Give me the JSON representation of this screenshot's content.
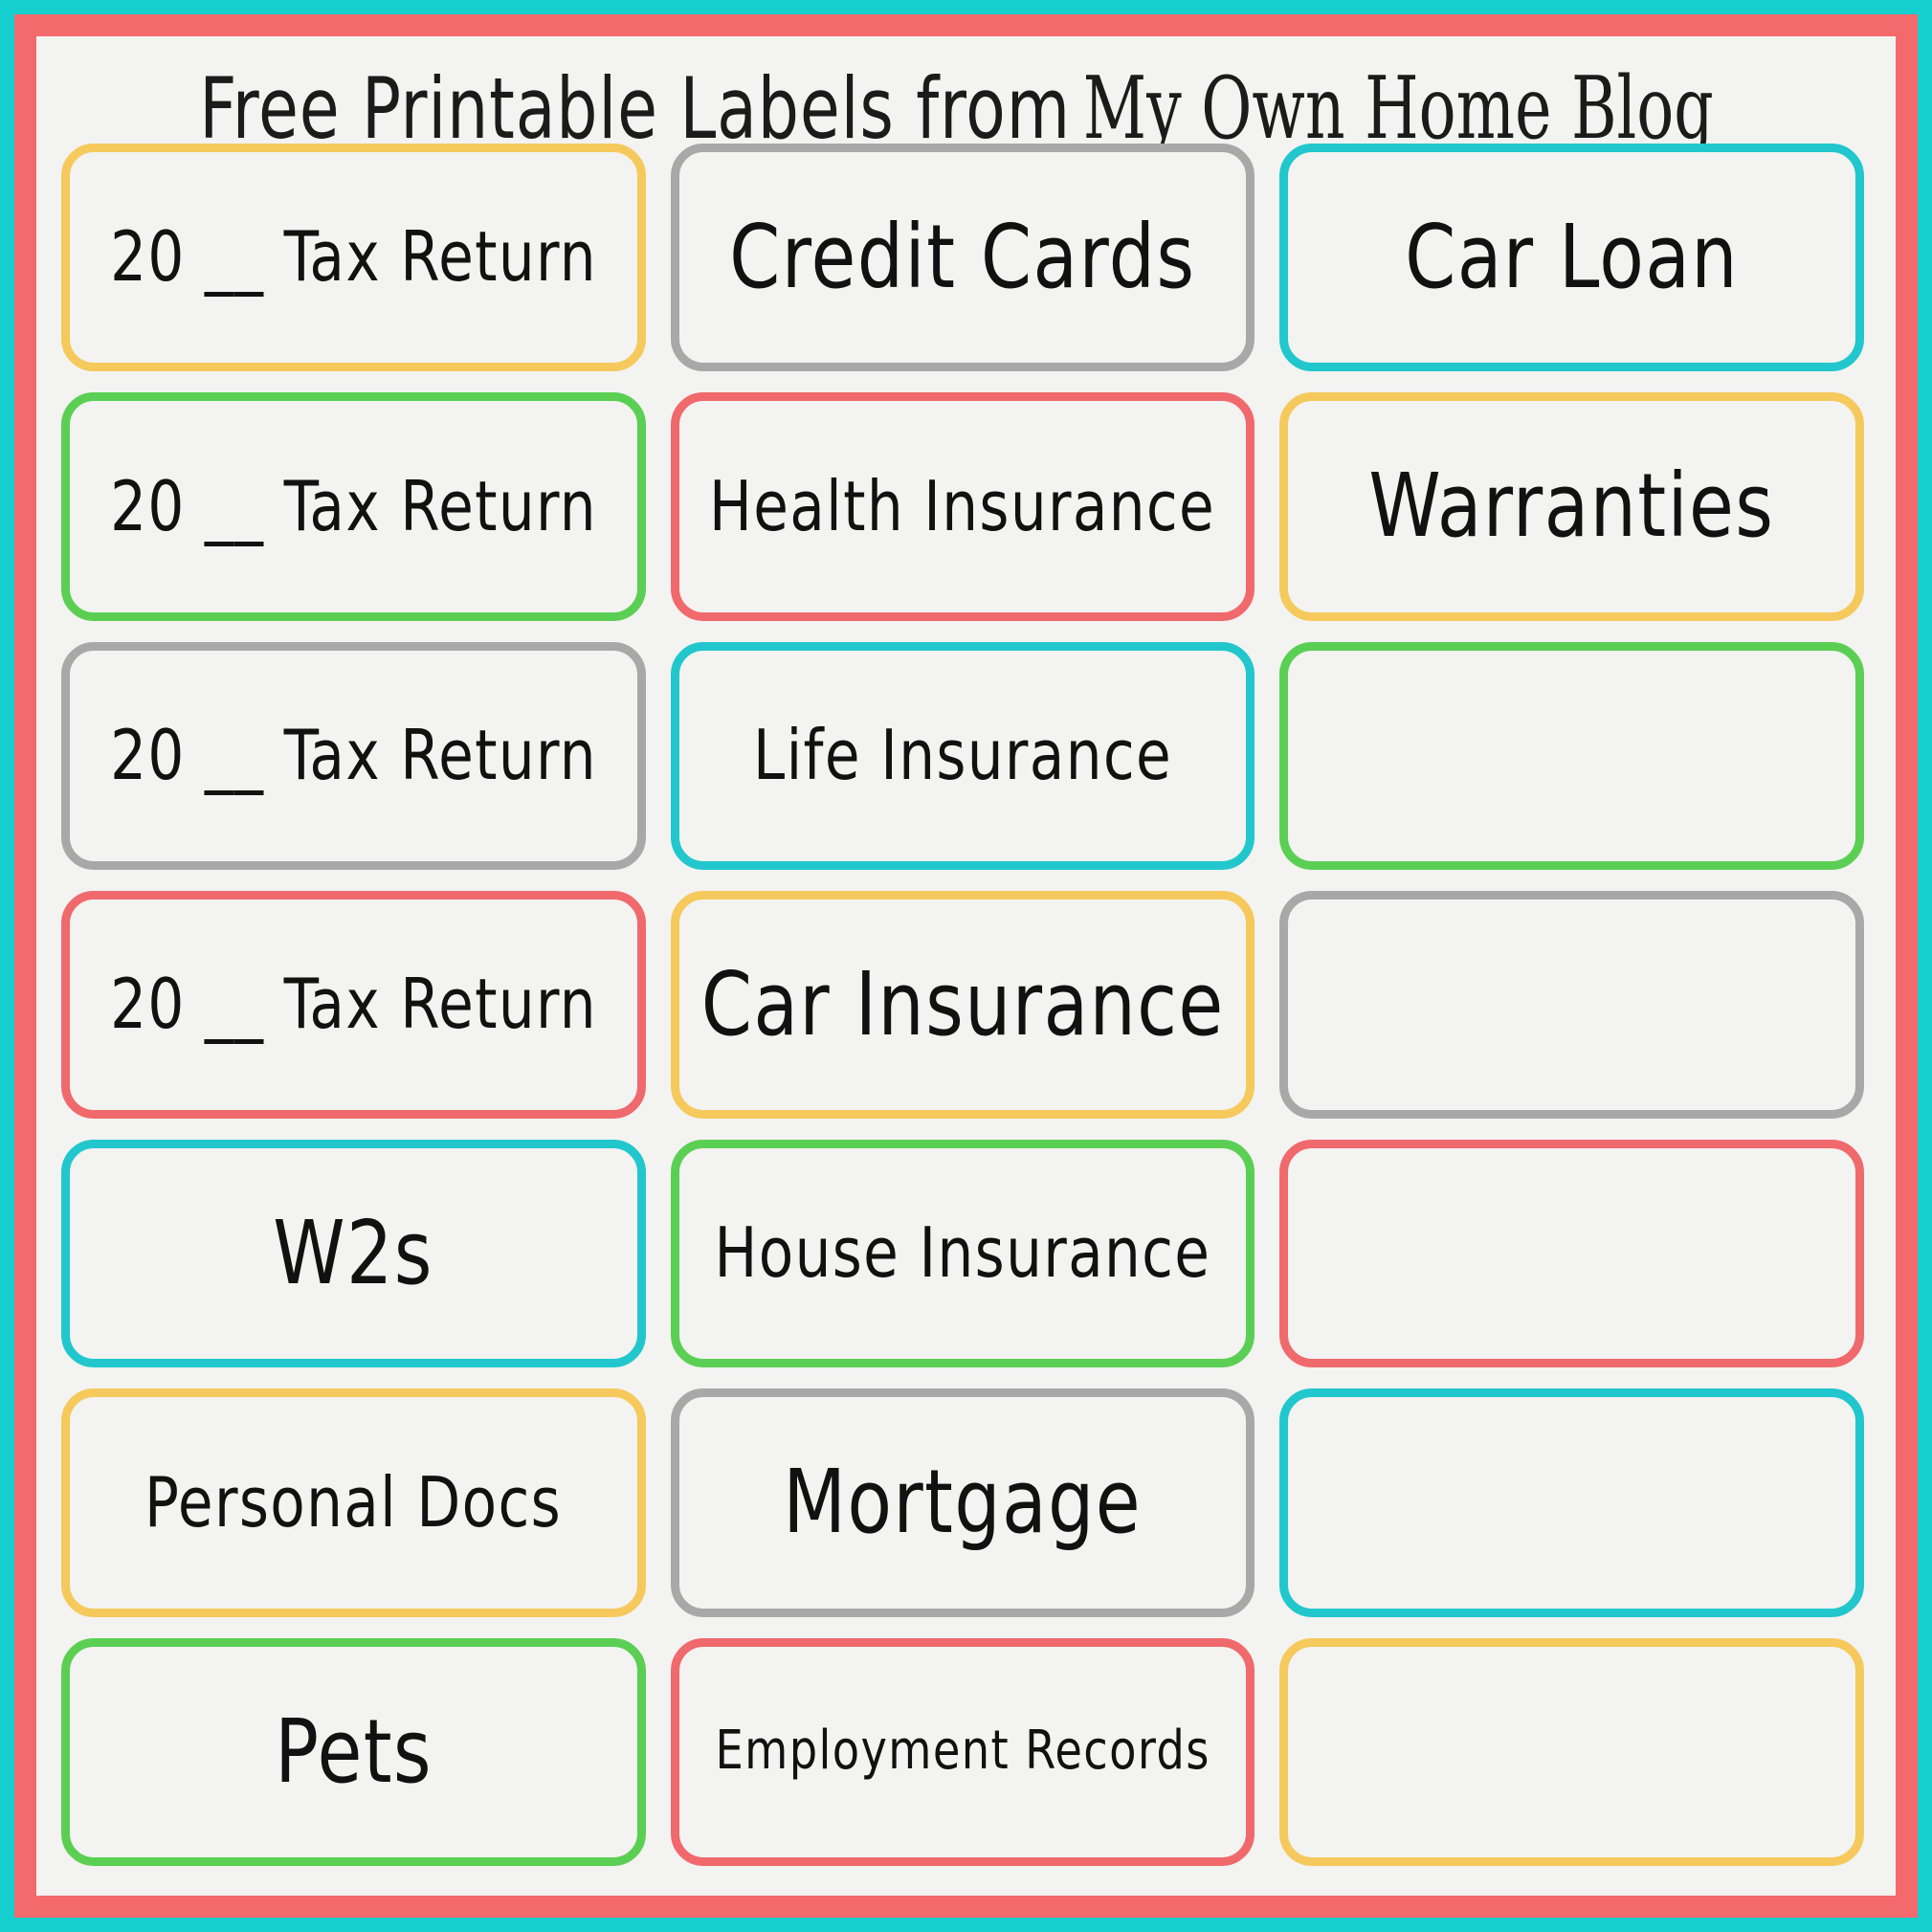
{
  "page": {
    "background": "#F3F3F1",
    "outer_frame_color": "#16CFCF",
    "inner_frame_color": "#F4696C"
  },
  "title": {
    "part_sans": "Free Printable Labels from",
    "part_serif": "My Own Home Blog"
  },
  "palette": {
    "yellow": "#F5C95C",
    "gray": "#A8A8A8",
    "teal": "#21C7CC",
    "green": "#5BCF53",
    "coral": "#F0696C"
  },
  "labels": [
    {
      "text": "20 __ Tax Return",
      "color": "yellow",
      "size": "medium"
    },
    {
      "text": "Credit Cards",
      "color": "gray",
      "size": "large"
    },
    {
      "text": "Car Loan",
      "color": "teal",
      "size": "large"
    },
    {
      "text": "20 __ Tax Return",
      "color": "green",
      "size": "medium"
    },
    {
      "text": "Health Insurance",
      "color": "coral",
      "size": "medium"
    },
    {
      "text": "Warranties",
      "color": "yellow",
      "size": "large"
    },
    {
      "text": "20 __ Tax Return",
      "color": "gray",
      "size": "medium"
    },
    {
      "text": "Life Insurance",
      "color": "teal",
      "size": "medium"
    },
    {
      "text": "",
      "color": "green",
      "size": "medium"
    },
    {
      "text": "20 __ Tax Return",
      "color": "coral",
      "size": "medium"
    },
    {
      "text": "Car Insurance",
      "color": "yellow",
      "size": "large"
    },
    {
      "text": "",
      "color": "gray",
      "size": "medium"
    },
    {
      "text": "W2s",
      "color": "teal",
      "size": "large"
    },
    {
      "text": "House Insurance",
      "color": "green",
      "size": "medium"
    },
    {
      "text": "",
      "color": "coral",
      "size": "medium"
    },
    {
      "text": "Personal Docs",
      "color": "yellow",
      "size": "medium"
    },
    {
      "text": "Mortgage",
      "color": "gray",
      "size": "large"
    },
    {
      "text": "",
      "color": "teal",
      "size": "medium"
    },
    {
      "text": "Pets",
      "color": "green",
      "size": "large"
    },
    {
      "text": "Employment Records",
      "color": "coral",
      "size": "small"
    },
    {
      "text": "",
      "color": "yellow",
      "size": "medium"
    }
  ]
}
